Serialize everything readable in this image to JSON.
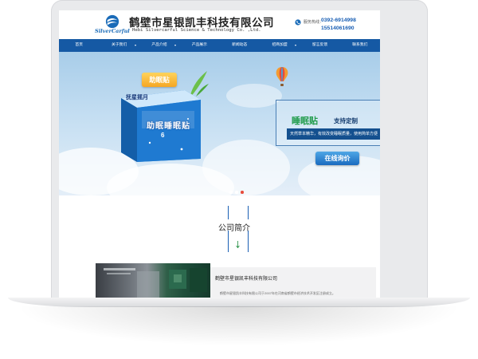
{
  "header": {
    "company_cn": "鹤壁市星银凯丰科技有限公司",
    "logo_en": "SilverCarful",
    "company_en": "Hebi Silvercarful Science & Technology Co. ,Ltd.",
    "hotline_label": "服务热线：",
    "hotline_1": "0392-6914998",
    "hotline_2": "15514061690"
  },
  "nav": {
    "items": [
      {
        "label": "首页",
        "has_dropdown": false
      },
      {
        "label": "关于我们",
        "has_dropdown": true
      },
      {
        "label": "产品介绍",
        "has_dropdown": true
      },
      {
        "label": "产品展示",
        "has_dropdown": false
      },
      {
        "label": "新闻动态",
        "has_dropdown": false
      },
      {
        "label": "招商加盟",
        "has_dropdown": true
      },
      {
        "label": "留言反馈",
        "has_dropdown": false
      },
      {
        "label": "联系我们",
        "has_dropdown": false
      }
    ]
  },
  "banner": {
    "badge": "助眠贴",
    "box_brand": "抚星摇月",
    "box_title": "助眠睡眠贴",
    "box_count": "6",
    "promo_title": "睡眠贴",
    "promo_sub": "支持定制",
    "promo_desc": "天然草本精华，有效改变睡眠质量，使用简单方便",
    "inquiry_label": "在线询价",
    "slides": 3,
    "active_slide": 3
  },
  "about": {
    "title": "公司简介",
    "heading": "鹤壁市星银凯丰科技有限公司",
    "intro": "鹤壁市星银凯丰科技有限公司于2007年在河南省鹤壁市经济技术开发区注册成立。"
  },
  "colors": {
    "nav_bg": "#1559a4",
    "brand_blue": "#1a5fb4",
    "promo_green": "#1f9b4a",
    "badge_orange": "#f5a623"
  }
}
